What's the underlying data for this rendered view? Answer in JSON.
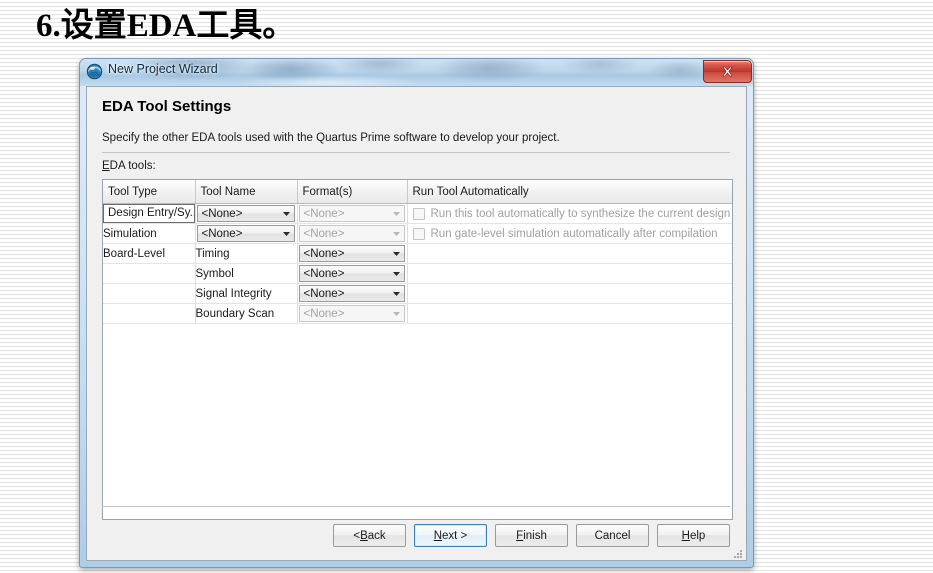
{
  "slide": {
    "title": "6.设置EDA工具。"
  },
  "dialog": {
    "window_title": "New Project Wizard",
    "close_label": "x",
    "heading": "EDA Tool Settings",
    "description": "Specify the other EDA tools used with the Quartus Prime software to develop your project.",
    "field_label_prefix": "E",
    "field_label_rest": "DA tools:"
  },
  "table": {
    "headers": [
      "Tool Type",
      "Tool Name",
      "Format(s)",
      "Run Tool Automatically"
    ],
    "rows": [
      {
        "tool_type": "Design Entry/Sy...",
        "tool_type_focused": true,
        "tool_name_value": "<None>",
        "tool_name_enabled": true,
        "format_value": "<None>",
        "format_enabled": false,
        "run_label": "Run this tool automatically to synthesize the current design",
        "run_checked": false,
        "run_enabled": false
      },
      {
        "tool_type": "Simulation",
        "tool_type_focused": false,
        "tool_name_value": "<None>",
        "tool_name_enabled": true,
        "format_value": "<None>",
        "format_enabled": false,
        "run_label": "Run gate-level simulation automatically after compilation",
        "run_checked": false,
        "run_enabled": false
      },
      {
        "tool_type": "Board-Level",
        "tool_type_focused": false,
        "tool_name_text": "Timing",
        "format_value": "<None>",
        "format_enabled": true,
        "run_label": "",
        "run_checked": false,
        "run_enabled": false
      },
      {
        "tool_type": "",
        "tool_type_focused": false,
        "tool_name_text": "Symbol",
        "format_value": "<None>",
        "format_enabled": true,
        "run_label": "",
        "run_checked": false,
        "run_enabled": false
      },
      {
        "tool_type": "",
        "tool_type_focused": false,
        "tool_name_text": "Signal Integrity",
        "format_value": "<None>",
        "format_enabled": true,
        "run_label": "",
        "run_checked": false,
        "run_enabled": false
      },
      {
        "tool_type": "",
        "tool_type_focused": false,
        "tool_name_text": "Boundary Scan",
        "format_value": "<None>",
        "format_enabled": false,
        "run_label": "",
        "run_checked": false,
        "run_enabled": false
      }
    ]
  },
  "buttons": [
    {
      "name": "back",
      "pre": "< ",
      "mnemonic": "B",
      "post": "ack",
      "default": false
    },
    {
      "name": "next",
      "pre": "",
      "mnemonic": "N",
      "post": "ext >",
      "default": true
    },
    {
      "name": "finish",
      "pre": "",
      "mnemonic": "F",
      "post": "inish",
      "default": false
    },
    {
      "name": "cancel",
      "pre": "Cancel",
      "mnemonic": "",
      "post": "",
      "default": false
    },
    {
      "name": "help",
      "pre": "",
      "mnemonic": "H",
      "post": "elp",
      "default": false
    }
  ],
  "colors": {
    "aero_border": "#7a98b8",
    "close_red": "#b8352c",
    "default_button_focus": "#3c7fb1",
    "client_bg": "#f0f0f0",
    "disabled_text": "#a0a0a0"
  }
}
